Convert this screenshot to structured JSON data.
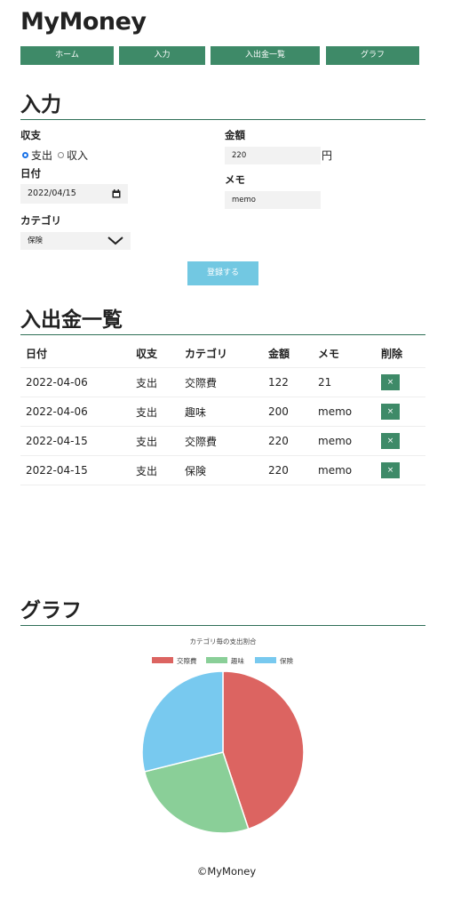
{
  "app": {
    "title": "MyMoney"
  },
  "nav": [
    "ホーム",
    "入力",
    "入出金一覧",
    "グラフ"
  ],
  "input_section": {
    "title": "入力",
    "type_label": "収支",
    "type_options": [
      "支出",
      "収入"
    ],
    "type_selected": "支出",
    "date_label": "日付",
    "date_value": "2022/04/15",
    "category_label": "カテゴリ",
    "category_value": "保険",
    "amount_label": "金額",
    "amount_value": "220",
    "amount_unit": "円",
    "memo_label": "メモ",
    "memo_value": "memo",
    "submit_label": "登録する"
  },
  "list_section": {
    "title": "入出金一覧",
    "headers": [
      "日付",
      "収支",
      "カテゴリ",
      "金額",
      "メモ",
      "削除"
    ],
    "delete_label": "×",
    "rows": [
      [
        "2022-04-06",
        "支出",
        "交際費",
        "122",
        "21"
      ],
      [
        "2022-04-06",
        "支出",
        "趣味",
        "200",
        "memo"
      ],
      [
        "2022-04-15",
        "支出",
        "交際費",
        "220",
        "memo"
      ],
      [
        "2022-04-15",
        "支出",
        "保険",
        "220",
        "memo"
      ]
    ]
  },
  "graph_section": {
    "title": "グラフ"
  },
  "chart_data": {
    "type": "pie",
    "title": "カテゴリ毎の支出割合",
    "labels": [
      "交際費",
      "趣味",
      "保険"
    ],
    "values": [
      342,
      200,
      220
    ],
    "colors": [
      "#dc6461",
      "#8acf98",
      "#78c9ef"
    ],
    "legend": "top"
  },
  "footer": "©MyMoney",
  "colors": {
    "accent": "#3e8a68",
    "submit": "#72c8e2"
  }
}
